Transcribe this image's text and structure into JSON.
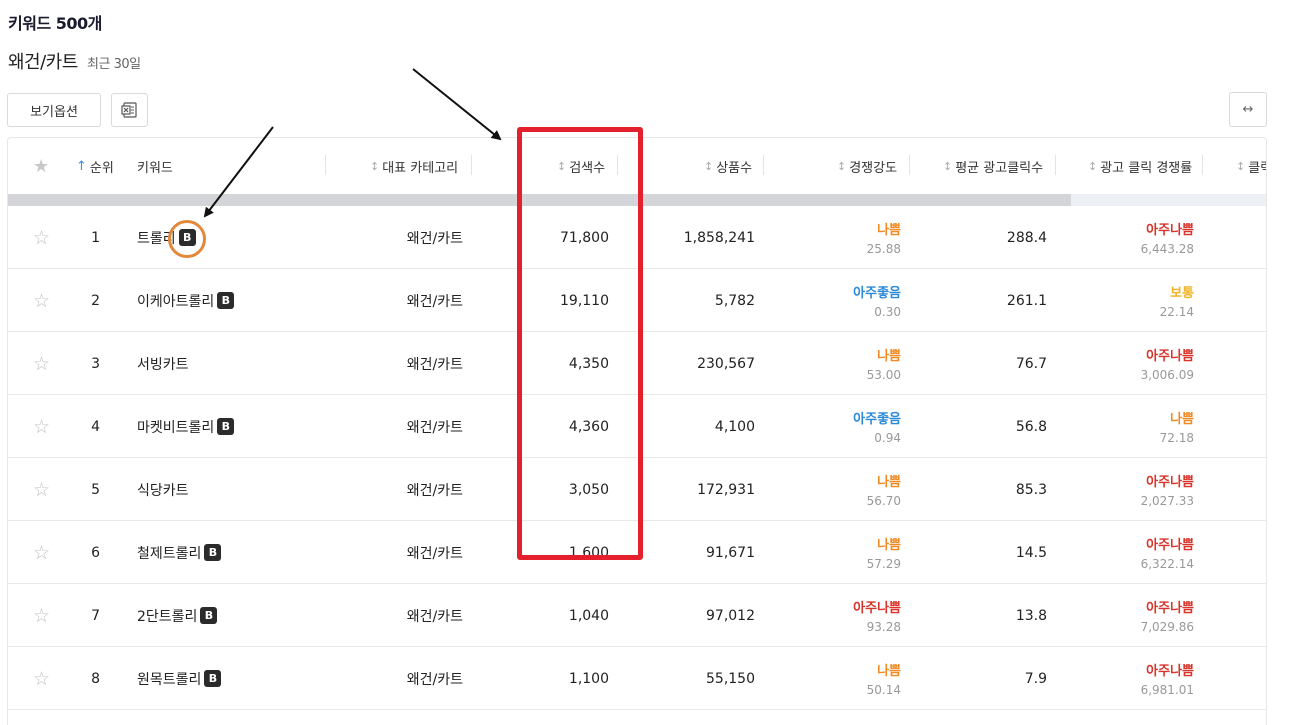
{
  "page": {
    "title": "키워드 500개",
    "category": "왜건/카트",
    "period": "최근 30일"
  },
  "toolbar": {
    "view_options_label": "보기옵션",
    "excel_icon": "excel-icon",
    "expand_icon_text": "↔"
  },
  "table": {
    "headers": {
      "favorite_icon": "star-icon",
      "rank": "순위",
      "keyword": "키워드",
      "category": "대표 카테고리",
      "search_volume": "검색수",
      "product_count": "상품수",
      "competition": "경쟁강도",
      "avg_ad_clicks": "평균 광고클릭수",
      "ad_click_competition": "광고 클릭 경쟁률",
      "next_partial": "클릭"
    },
    "sort_icon": "↕",
    "sort_active_icon": "↑",
    "star_glyph": "☆",
    "header_star_glyph": "★",
    "badge_text": "B",
    "rows": [
      {
        "rank": "1",
        "keyword": "트롤리",
        "badge": true,
        "category": "왜건/카트",
        "search": "71,800",
        "products": "1,858,241",
        "comp_label": "나쁨",
        "comp_value": "25.88",
        "comp_color": "#f08a24",
        "clicks": "288.4",
        "ad_label": "아주나쁨",
        "ad_value": "6,443.28",
        "ad_color": "#d9342b"
      },
      {
        "rank": "2",
        "keyword": "이케아트롤리",
        "badge": true,
        "category": "왜건/카트",
        "search": "19,110",
        "products": "5,782",
        "comp_label": "아주좋음",
        "comp_value": "0.30",
        "comp_color": "#2d8ad8",
        "clicks": "261.1",
        "ad_label": "보통",
        "ad_value": "22.14",
        "ad_color": "#f0b323"
      },
      {
        "rank": "3",
        "keyword": "서빙카트",
        "badge": false,
        "category": "왜건/카트",
        "search": "4,350",
        "products": "230,567",
        "comp_label": "나쁨",
        "comp_value": "53.00",
        "comp_color": "#f08a24",
        "clicks": "76.7",
        "ad_label": "아주나쁨",
        "ad_value": "3,006.09",
        "ad_color": "#d9342b"
      },
      {
        "rank": "4",
        "keyword": "마켓비트롤리",
        "badge": true,
        "category": "왜건/카트",
        "search": "4,360",
        "products": "4,100",
        "comp_label": "아주좋음",
        "comp_value": "0.94",
        "comp_color": "#2d8ad8",
        "clicks": "56.8",
        "ad_label": "나쁨",
        "ad_value": "72.18",
        "ad_color": "#f08a24"
      },
      {
        "rank": "5",
        "keyword": "식당카트",
        "badge": false,
        "category": "왜건/카트",
        "search": "3,050",
        "products": "172,931",
        "comp_label": "나쁨",
        "comp_value": "56.70",
        "comp_color": "#f08a24",
        "clicks": "85.3",
        "ad_label": "아주나쁨",
        "ad_value": "2,027.33",
        "ad_color": "#d9342b"
      },
      {
        "rank": "6",
        "keyword": "철제트롤리",
        "badge": true,
        "category": "왜건/카트",
        "search": "1,600",
        "products": "91,671",
        "comp_label": "나쁨",
        "comp_value": "57.29",
        "comp_color": "#f08a24",
        "clicks": "14.5",
        "ad_label": "아주나쁨",
        "ad_value": "6,322.14",
        "ad_color": "#d9342b"
      },
      {
        "rank": "7",
        "keyword": "2단트롤리",
        "badge": true,
        "category": "왜건/카트",
        "search": "1,040",
        "products": "97,012",
        "comp_label": "아주나쁨",
        "comp_value": "93.28",
        "comp_color": "#d9342b",
        "clicks": "13.8",
        "ad_label": "아주나쁨",
        "ad_value": "7,029.86",
        "ad_color": "#d9342b"
      },
      {
        "rank": "8",
        "keyword": "원목트롤리",
        "badge": true,
        "category": "왜건/카트",
        "search": "1,100",
        "products": "55,150",
        "comp_label": "나쁨",
        "comp_value": "50.14",
        "comp_color": "#f08a24",
        "clicks": "7.9",
        "ad_label": "아주나쁨",
        "ad_value": "6,981.01",
        "ad_color": "#d9342b"
      }
    ]
  },
  "annotations": {
    "highlight_box_color": "#e3202b",
    "badge_circle_color": "#e2883a",
    "arrow_color": "#111111"
  }
}
